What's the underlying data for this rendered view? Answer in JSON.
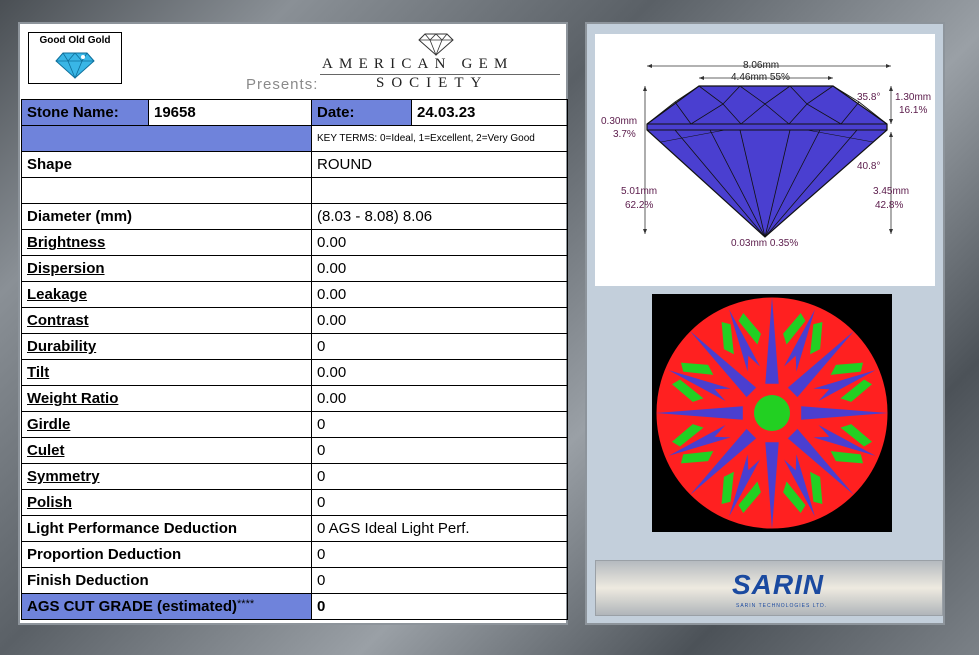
{
  "header": {
    "logo_text": "Good Old Gold",
    "presents": "Presents:",
    "ags_line1": "AMERICAN GEM",
    "ags_line2": "SOCIETY"
  },
  "report": {
    "stone_name_label": "Stone Name:",
    "stone_name": "19658",
    "date_label": "Date:",
    "date": "24.03.23",
    "key_terms": "KEY TERMS: 0=Ideal, 1=Excellent, 2=Very Good",
    "rows": [
      {
        "label": "Shape",
        "value": "ROUND"
      },
      {
        "label": "",
        "value": ""
      },
      {
        "label": "Diameter (mm)",
        "value": "(8.03 - 8.08) 8.06"
      },
      {
        "label": "Brightness",
        "value": "0.00"
      },
      {
        "label": "Dispersion",
        "value": "0.00"
      },
      {
        "label": "Leakage",
        "value": "0.00"
      },
      {
        "label": "Contrast",
        "value": "0.00"
      },
      {
        "label": "Durability",
        "value": "0"
      },
      {
        "label": "Tilt",
        "value": "0.00"
      },
      {
        "label": "Weight Ratio",
        "value": "0.00"
      },
      {
        "label": "Girdle",
        "value": "0"
      },
      {
        "label": "Culet",
        "value": "0"
      },
      {
        "label": "Symmetry",
        "value": "0"
      },
      {
        "label": "Polish",
        "value": "0"
      },
      {
        "label": "Light Performance Deduction",
        "value": "0 AGS Ideal Light Perf."
      },
      {
        "label": "Proportion Deduction",
        "value": "0"
      },
      {
        "label": "Finish Deduction",
        "value": "0"
      }
    ],
    "cut_grade_label": "AGS CUT GRADE (estimated)",
    "cut_grade_stars": "****",
    "cut_grade_value": "0"
  },
  "diagram": {
    "diameter": "8.06mm",
    "table": "4.46mm 55%",
    "crown_angle": "35.8°",
    "crown_height_mm": "1.30mm",
    "crown_height_pct": "16.1%",
    "girdle_mm": "0.30mm",
    "girdle_pct": "3.7%",
    "pavilion_angle": "40.8°",
    "total_depth_mm": "5.01mm",
    "total_depth_pct": "62.2%",
    "pavilion_depth_mm": "3.45mm",
    "pavilion_depth_pct": "42.8%",
    "culet": "0.03mm 0.35%"
  },
  "sarin": {
    "brand": "SARIN",
    "tagline": "SARIN TECHNOLOGIES LTD."
  },
  "colors": {
    "label_blue": "#6f83db",
    "diamond_blue": "#4a3fd0",
    "ideal_red": "#ff2020",
    "ideal_green": "#22d022"
  }
}
